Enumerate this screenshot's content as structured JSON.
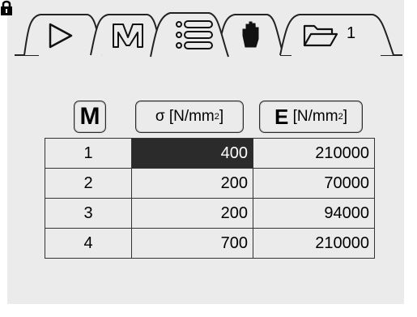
{
  "tabs": [
    {
      "name": "play",
      "icon": "play-triangle-icon"
    },
    {
      "name": "material",
      "icon": "m-bracket-icon"
    },
    {
      "name": "list",
      "icon": "list-icon",
      "active": true
    },
    {
      "name": "manual",
      "icon": "hand-icon"
    },
    {
      "name": "folder",
      "icon": "folder-icon",
      "label": "1"
    }
  ],
  "lock_icon": "padlock-icon",
  "table": {
    "headers": [
      {
        "symbol": "M",
        "text": ""
      },
      {
        "symbol": "σ",
        "text": "[N/mm",
        "sup": "2",
        "close": "]"
      },
      {
        "symbol": "E",
        "text": "[N/mm",
        "sup": "2",
        "close": "]"
      }
    ],
    "rows": [
      {
        "m": "1",
        "sigma": "400",
        "e": "210000"
      },
      {
        "m": "2",
        "sigma": "200",
        "e": "70000"
      },
      {
        "m": "3",
        "sigma": "200",
        "e": "94000"
      },
      {
        "m": "4",
        "sigma": "700",
        "e": "210000"
      }
    ],
    "selected": {
      "row": 0,
      "col": "sigma"
    }
  },
  "colors": {
    "background": "#ebebeb",
    "selected": "#2b2b2b",
    "text": "#000000"
  }
}
